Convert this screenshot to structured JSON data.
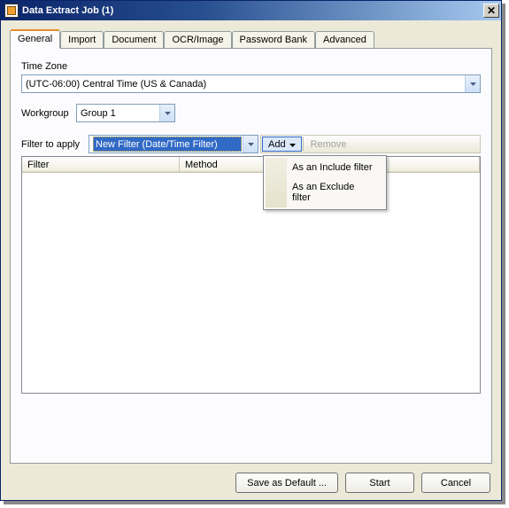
{
  "window": {
    "title": "Data Extract Job (1)"
  },
  "tabs": {
    "items": [
      "General",
      "Import",
      "Document",
      "OCR/Image",
      "Password Bank",
      "Advanced"
    ],
    "active": 0
  },
  "general": {
    "time_zone_label": "Time Zone",
    "time_zone_value": "(UTC-06:00) Central Time (US & Canada)",
    "workgroup_label": "Workgroup",
    "workgroup_value": "Group 1",
    "filter_label": "Filter to apply",
    "filter_value": "New Filter (Date/Time Filter)",
    "toolbar": {
      "add": "Add",
      "remove": "Remove"
    },
    "add_menu": {
      "include": "As an Include filter",
      "exclude": "As an Exclude filter"
    },
    "columns": {
      "filter": "Filter",
      "method": "Method"
    }
  },
  "buttons": {
    "save_default": "Save as Default ...",
    "start": "Start",
    "cancel": "Cancel"
  }
}
